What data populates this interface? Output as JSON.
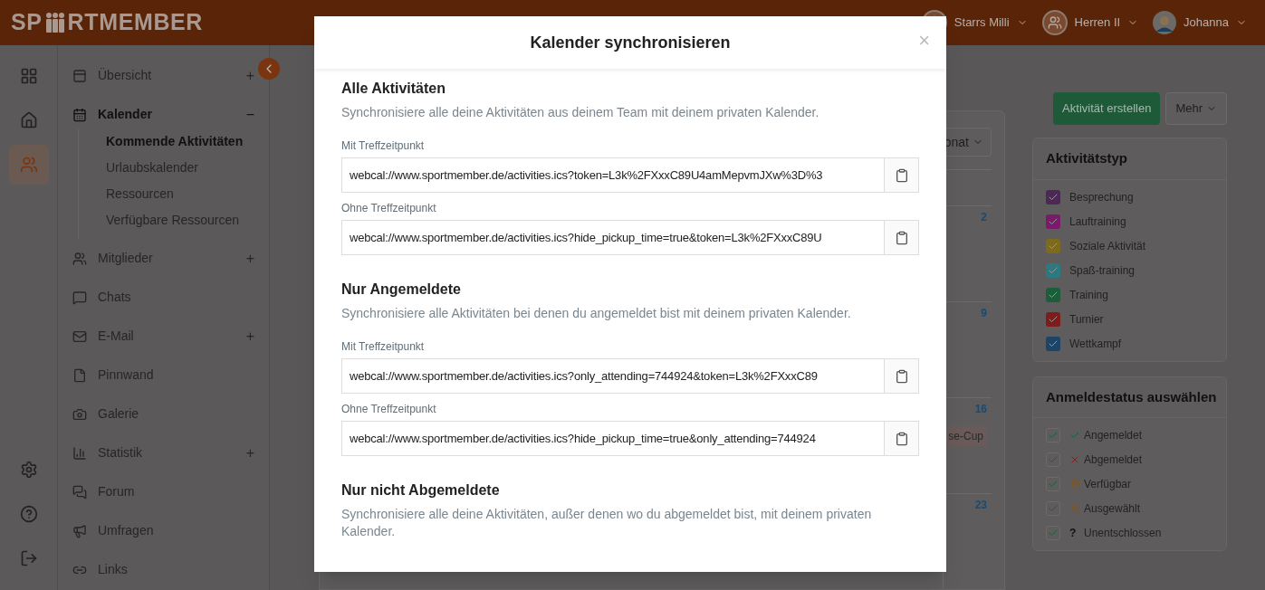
{
  "header": {
    "logo_left": "SP",
    "logo_right": "RTMEMBER",
    "menus": [
      {
        "kind": "club",
        "label": "Starrs Milli"
      },
      {
        "kind": "team",
        "label": "Herren II"
      },
      {
        "kind": "user",
        "label": "Johanna"
      }
    ]
  },
  "rail": [
    {
      "kind": "grid",
      "selected": false
    },
    {
      "kind": "home",
      "selected": false
    },
    {
      "kind": "team",
      "selected": true
    },
    {
      "kind": "settings",
      "selected": false
    },
    {
      "kind": "help",
      "selected": false
    },
    {
      "kind": "logout",
      "selected": false
    }
  ],
  "nav": [
    {
      "kind": "overview",
      "label": "Übersicht",
      "toggle": "+",
      "expanded": false
    },
    {
      "kind": "calendar",
      "label": "Kalender",
      "toggle": "−",
      "expanded": true,
      "children": [
        {
          "label": "Kommende Aktivitäten",
          "selected": true
        },
        {
          "label": "Urlaubskalender",
          "selected": false
        },
        {
          "label": "Ressourcen",
          "selected": false
        },
        {
          "label": "Verfügbare Ressourcen",
          "selected": false
        }
      ]
    },
    {
      "kind": "members",
      "label": "Mitglieder",
      "toggle": "+",
      "expanded": false
    },
    {
      "kind": "chat",
      "label": "Chats",
      "expanded": false
    },
    {
      "kind": "mail",
      "label": "E-Mail",
      "toggle": "+",
      "expanded": false
    },
    {
      "kind": "board",
      "label": "Pinnwand",
      "expanded": false
    },
    {
      "kind": "camera",
      "label": "Galerie",
      "expanded": false
    },
    {
      "kind": "stats",
      "label": "Statistik",
      "toggle": "+",
      "expanded": false
    },
    {
      "kind": "forum",
      "label": "Forum",
      "expanded": false
    },
    {
      "kind": "poll",
      "label": "Umfragen",
      "expanded": false
    },
    {
      "kind": "link",
      "label": "Links",
      "expanded": false
    }
  ],
  "calendar": {
    "view_select": "onat",
    "days": [
      "2",
      "9",
      "16",
      "23"
    ],
    "event": "se-Cup"
  },
  "actions": {
    "create": "Aktivität erstellen",
    "more": "Mehr"
  },
  "activity_types": {
    "title": "Aktivitätstyp",
    "items": [
      {
        "label": "Besprechung",
        "color": "#4a2a52",
        "checked": true
      },
      {
        "label": "Lauftraining",
        "color": "#7a1a6a",
        "checked": true
      },
      {
        "label": "Soziale Aktivität",
        "color": "#7d6a1c",
        "checked": true
      },
      {
        "label": "Spaß-training",
        "color": "#2a7a80",
        "checked": true
      },
      {
        "label": "Training",
        "color": "#1c5e3a",
        "checked": true
      },
      {
        "label": "Turnier",
        "color": "#7e1c1c",
        "checked": true
      },
      {
        "label": "Wettkampf",
        "color": "#1c4466",
        "checked": true
      }
    ]
  },
  "status": {
    "title": "Anmeldestatus auswählen",
    "items": [
      {
        "kind": "accepted",
        "label": "Angemeldet",
        "checked": true
      },
      {
        "kind": "declined",
        "label": "Abgemeldet",
        "checked": true
      },
      {
        "kind": "available",
        "label": "Verfügbar",
        "checked": true
      },
      {
        "kind": "selected",
        "label": "Ausgewählt",
        "checked": true
      },
      {
        "kind": "undecided",
        "glyph": "?",
        "label": "Unentschlossen",
        "checked": true
      }
    ]
  },
  "modal": {
    "title": "Kalender synchronisieren",
    "close": "×",
    "sections": [
      {
        "title": "Alle Aktivitäten",
        "description": "Synchronisiere alle deine Aktivitäten aus deinem Team mit deinem privaten Kalender.",
        "links": [
          {
            "label": "Mit Treffzeitpunkt",
            "value": "webcal://www.sportmember.de/activities.ics?token=L3k%2FXxxC89U4amMepvmJXw%3D%3"
          },
          {
            "label": "Ohne Treffzeitpunkt",
            "value": "webcal://www.sportmember.de/activities.ics?hide_pickup_time=true&token=L3k%2FXxxC89U"
          }
        ]
      },
      {
        "title": "Nur Angemeldete",
        "description": "Synchronisiere alle Aktivitäten bei denen du angemeldet bist mit deinem privaten Kalender.",
        "links": [
          {
            "label": "Mit Treffzeitpunkt",
            "value": "webcal://www.sportmember.de/activities.ics?only_attending=744924&token=L3k%2FXxxC89"
          },
          {
            "label": "Ohne Treffzeitpunkt",
            "value": "webcal://www.sportmember.de/activities.ics?hide_pickup_time=true&only_attending=744924"
          }
        ]
      },
      {
        "title": "Nur nicht Abgemeldete",
        "description": "Synchronisiere alle deine Aktivitäten, außer denen wo du abgemeldet bist, mit deinem privaten Kalender."
      }
    ]
  }
}
